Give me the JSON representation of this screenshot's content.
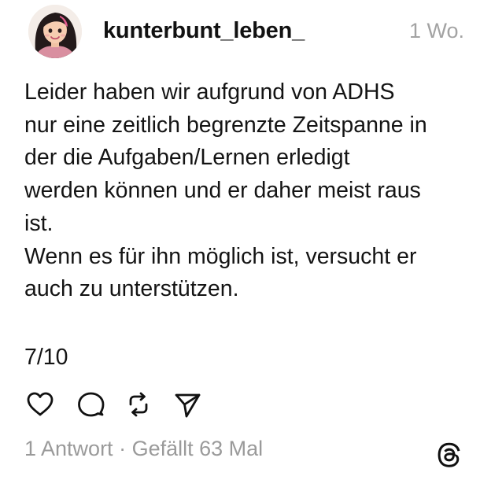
{
  "post": {
    "username": "kunterbunt_leben_",
    "timestamp": "1 Wo.",
    "body_lines": [
      "Leider haben wir aufgrund von ADHS",
      "nur eine zeitlich begrenzte Zeitspanne in",
      "der die Aufgaben/Lernen erledigt",
      "werden können und er daher meist raus",
      "ist.",
      "Wenn es für ihn möglich ist, versucht er",
      "auch zu unterstützen."
    ],
    "counter": "7/10",
    "replies": "1 Antwort",
    "separator": "·",
    "likes": "Gefällt 63 Mal"
  },
  "icons": {
    "like": "heart-icon",
    "reply": "comment-bubble-icon",
    "repost": "repost-arrows-icon",
    "share": "send-paper-plane-icon",
    "brand": "threads-logo-icon"
  },
  "colors": {
    "text": "#141414",
    "muted": "#9a9a9a",
    "background": "#ffffff"
  }
}
